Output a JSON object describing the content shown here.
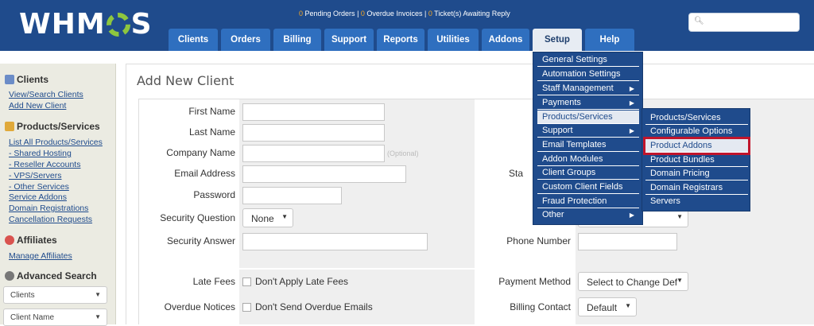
{
  "header": {
    "logo_text": "WHMCS",
    "stats": {
      "pending_orders_count": "0",
      "pending_orders_label": " Pending Orders",
      "overdue_invoices_count": "0",
      "overdue_invoices_label": " Overdue Invoices",
      "tickets_count": "0",
      "tickets_label": " Ticket(s) Awaiting Reply",
      "separator": " | "
    },
    "search_icon": "search-icon",
    "nav": [
      "Clients",
      "Orders",
      "Billing",
      "Support",
      "Reports",
      "Utilities",
      "Addons",
      "Setup",
      "Help"
    ],
    "active_tab": "Setup"
  },
  "sidebar": {
    "clients_heading": "Clients",
    "clients_links": [
      "View/Search Clients",
      "Add New Client"
    ],
    "products_heading": "Products/Services",
    "products_links": [
      "List All Products/Services",
      "- Shared Hosting",
      "- Reseller Accounts",
      "- VPS/Servers",
      "- Other Services",
      "Service Addons",
      "Domain Registrations",
      "Cancellation Requests"
    ],
    "affiliates_heading": "Affiliates",
    "affiliates_links": [
      "Manage Affiliates"
    ],
    "advanced_search_heading": "Advanced Search",
    "search_type": "Clients",
    "search_field": "Client Name"
  },
  "page": {
    "title": "Add New Client"
  },
  "form": {
    "first_name_label": "First Name",
    "last_name_label": "Last Name",
    "company_name_label": "Company Name",
    "company_optional": "(Optional)",
    "email_label": "Email Address",
    "password_label": "Password",
    "security_question_label": "Security Question",
    "security_question_value": "None",
    "security_answer_label": "Security Answer",
    "late_fees_label": "Late Fees",
    "late_fees_option": "Don't Apply Late Fees",
    "overdue_notices_label": "Overdue Notices",
    "overdue_notices_option": "Don't Send Overdue Emails",
    "state_label_partial": "Sta",
    "phone_label": "Phone Number",
    "payment_method_label": "Payment Method",
    "payment_method_value": "Select to Change Def",
    "billing_contact_label": "Billing Contact",
    "billing_contact_value": "Default"
  },
  "setup_menu": {
    "items": [
      "General Settings",
      "Automation Settings",
      "Staff Management",
      "Payments",
      "Products/Services",
      "Support",
      "Email Templates",
      "Addon Modules",
      "Client Groups",
      "Custom Client Fields",
      "Fraud Protection",
      "Other"
    ],
    "hovered": "Products/Services"
  },
  "products_submenu": {
    "items": [
      "Products/Services",
      "Configurable Options",
      "Product Addons",
      "Product Bundles",
      "Domain Pricing",
      "Domain Registrars",
      "Servers"
    ],
    "highlighted": "Product Addons"
  },
  "colors": {
    "header_bg": "#1f4b8c",
    "tab_bg": "#2f6fbf",
    "stat_count": "#f5a623",
    "logo_accent": "#8dc63f",
    "highlight_border": "#c0152c"
  }
}
